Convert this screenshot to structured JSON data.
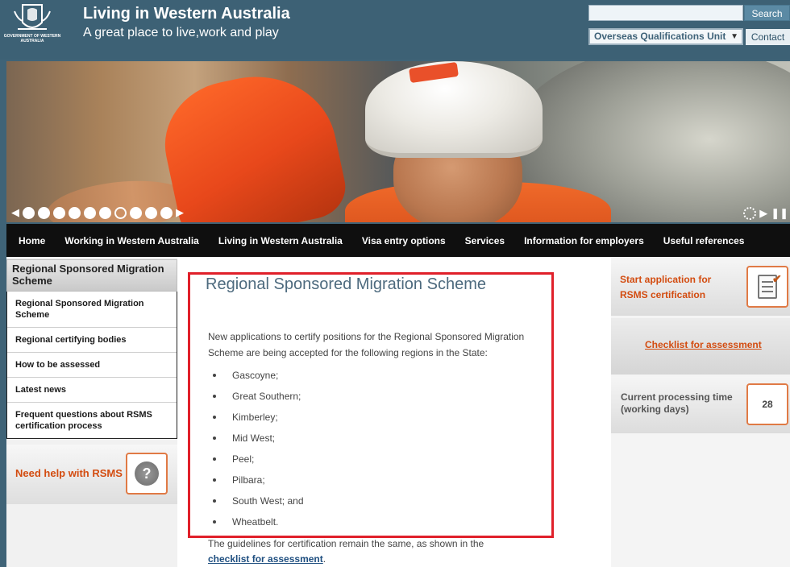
{
  "header": {
    "crest_text": "GOVERNMENT OF WESTERN AUSTRALIA",
    "title": "Living in Western Australia",
    "subtitle": "A great place to live,work and play",
    "search_value": "",
    "search_button": "Search",
    "unit_select": "Overseas Qualifications Unit",
    "contact_button": "Contact"
  },
  "banner": {
    "slide_count": 10,
    "active_slide": 7,
    "prev_arrow": "◀",
    "next_arrow": "▶",
    "play_icon": "play-icon",
    "pause_icon": "pause-icon"
  },
  "nav": {
    "items": [
      "Home",
      "Working in Western Australia",
      "Living in Western Australia",
      "Visa entry options",
      "Services",
      "Information for employers",
      "Useful references"
    ]
  },
  "sidebar": {
    "header": "Regional Sponsored Migration Scheme",
    "items": [
      "Regional Sponsored Migration Scheme",
      "Regional certifying bodies",
      "How to be assessed",
      "Latest news",
      "Frequent questions about RSMS certification process"
    ],
    "help_label": "Need help with RSMS",
    "help_glyph": "?"
  },
  "main": {
    "heading": "Regional Sponsored Migration Scheme",
    "intro": "New applications to certify positions for the Regional Sponsored Migration Scheme are being accepted for the following regions in the State:",
    "regions": [
      "Gascoyne;",
      "Great Southern;",
      "Kimberley;",
      "Mid West;",
      "Peel;",
      "Pilbara;",
      "South West; and",
      "Wheatbelt."
    ],
    "guidelines_text": "The guidelines for certification remain the same, as shown in the",
    "guidelines_link": "checklist for assessment",
    "guidelines_end": "."
  },
  "right": {
    "start_app": "Start application for RSMS certification",
    "checklist_link": "Checklist for assessment",
    "processing_label": "Current processing time (working days)",
    "processing_days": "28",
    "check_glyph": "✔"
  },
  "colors": {
    "header_bg": "#3d6175",
    "accent_orange": "#d34c10",
    "nav_bg": "#0f0f0f",
    "highlight_red": "#e0202a"
  }
}
